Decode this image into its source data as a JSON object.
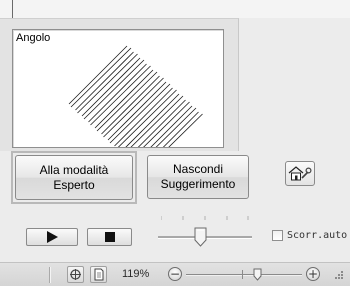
{
  "preview": {
    "label": "Angolo"
  },
  "buttons": {
    "expert_line1": "Alla modalità",
    "expert_line2": "Esperto",
    "hint_line1": "Nascondi",
    "hint_line2": "Suggerimento"
  },
  "icons": {
    "settings_button": "home-wrench-icon",
    "play": "play-icon",
    "stop": "stop-icon",
    "status_icon_1": "stitch-view-icon",
    "status_icon_2": "page-view-icon",
    "zoom_out": "minus-icon",
    "zoom_in": "plus-icon"
  },
  "playback": {
    "speed_level": 0.45
  },
  "autoscroll": {
    "label": "Scorr.auto",
    "checked": false
  },
  "status": {
    "zoom": "119%",
    "zoom_minus_symbol": "−",
    "zoom_plus_symbol": "+"
  },
  "colors": {
    "background": "#ececec",
    "preview_background": "#ffffff"
  }
}
